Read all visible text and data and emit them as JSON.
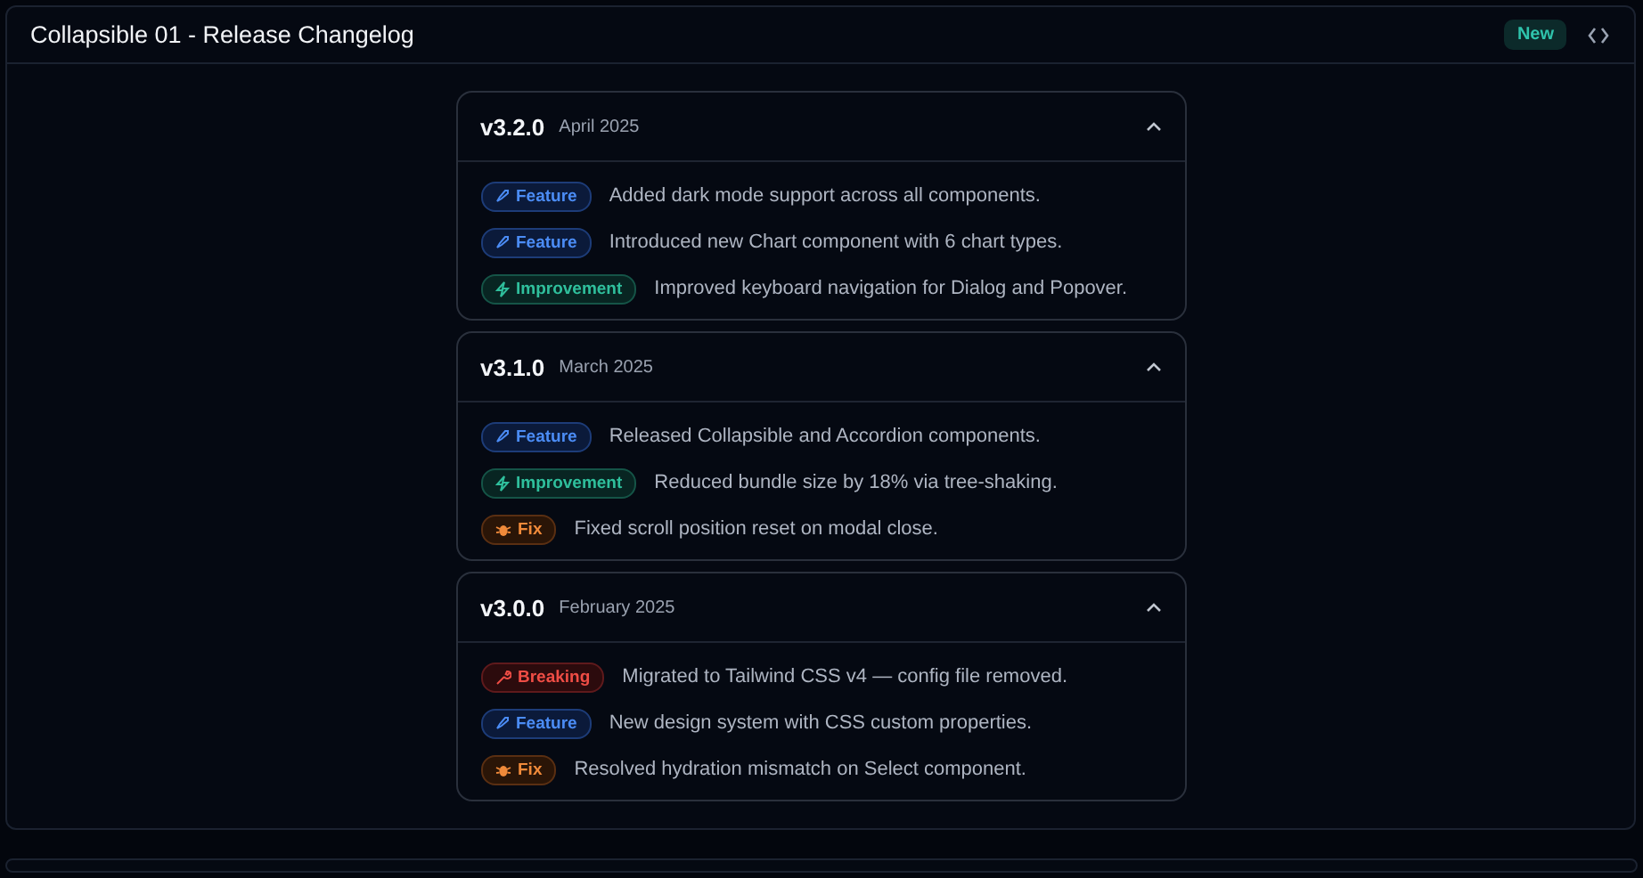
{
  "panel": {
    "title": "Collapsible 01 - Release Changelog",
    "badge": "New"
  },
  "releases": [
    {
      "version": "v3.2.0",
      "date": "April 2025",
      "expanded": true,
      "entries": [
        {
          "kind": "feature",
          "tag": "Feature",
          "text": "Added dark mode support across all components."
        },
        {
          "kind": "feature",
          "tag": "Feature",
          "text": "Introduced new Chart component with 6 chart types."
        },
        {
          "kind": "improvement",
          "tag": "Improvement",
          "text": "Improved keyboard navigation for Dialog and Popover."
        }
      ]
    },
    {
      "version": "v3.1.0",
      "date": "March 2025",
      "expanded": true,
      "entries": [
        {
          "kind": "feature",
          "tag": "Feature",
          "text": "Released Collapsible and Accordion components."
        },
        {
          "kind": "improvement",
          "tag": "Improvement",
          "text": "Reduced bundle size by 18% via tree-shaking."
        },
        {
          "kind": "fix",
          "tag": "Fix",
          "text": "Fixed scroll position reset on modal close."
        }
      ]
    },
    {
      "version": "v3.0.0",
      "date": "February 2025",
      "expanded": true,
      "entries": [
        {
          "kind": "breaking",
          "tag": "Breaking",
          "text": "Migrated to Tailwind CSS v4 — config file removed."
        },
        {
          "kind": "feature",
          "tag": "Feature",
          "text": "New design system with CSS custom properties."
        },
        {
          "kind": "fix",
          "tag": "Fix",
          "text": "Resolved hydration mismatch on Select component."
        }
      ]
    }
  ]
}
